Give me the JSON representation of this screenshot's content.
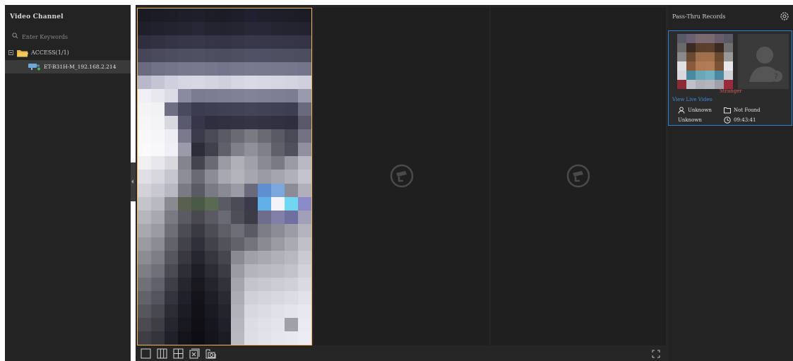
{
  "left_panel": {
    "title": "Video Channel",
    "search_placeholder": "Enter Keywords",
    "group": {
      "label": "ACCESS(1/1)"
    },
    "items": [
      {
        "label": "ET-B31H-M_192.168.2.214"
      }
    ]
  },
  "video": {
    "panes": [
      {
        "state": "live",
        "selected": true
      },
      {
        "state": "no-video"
      },
      {
        "state": "no-video"
      }
    ],
    "toolbar": {
      "tools": [
        "layout-1-icon",
        "layout-3-icon",
        "layout-4-icon",
        "close-all-icon",
        "snapshot-icon"
      ],
      "fullscreen": "fullscreen-icon"
    }
  },
  "right_panel": {
    "title": "Pass-Thru Records",
    "record": {
      "match_status": "Stranger",
      "link": "View Live Video",
      "person": "Unknown",
      "lib_status": "Not Found",
      "sub_label": "Unknown",
      "time": "09:43:41"
    }
  },
  "colors": {
    "accent_selected": "#f0b45a",
    "link": "#3f8ee0",
    "stranger": "#e05a5a",
    "card_border": "#2e7fd4",
    "panel_bg": "#232323"
  }
}
